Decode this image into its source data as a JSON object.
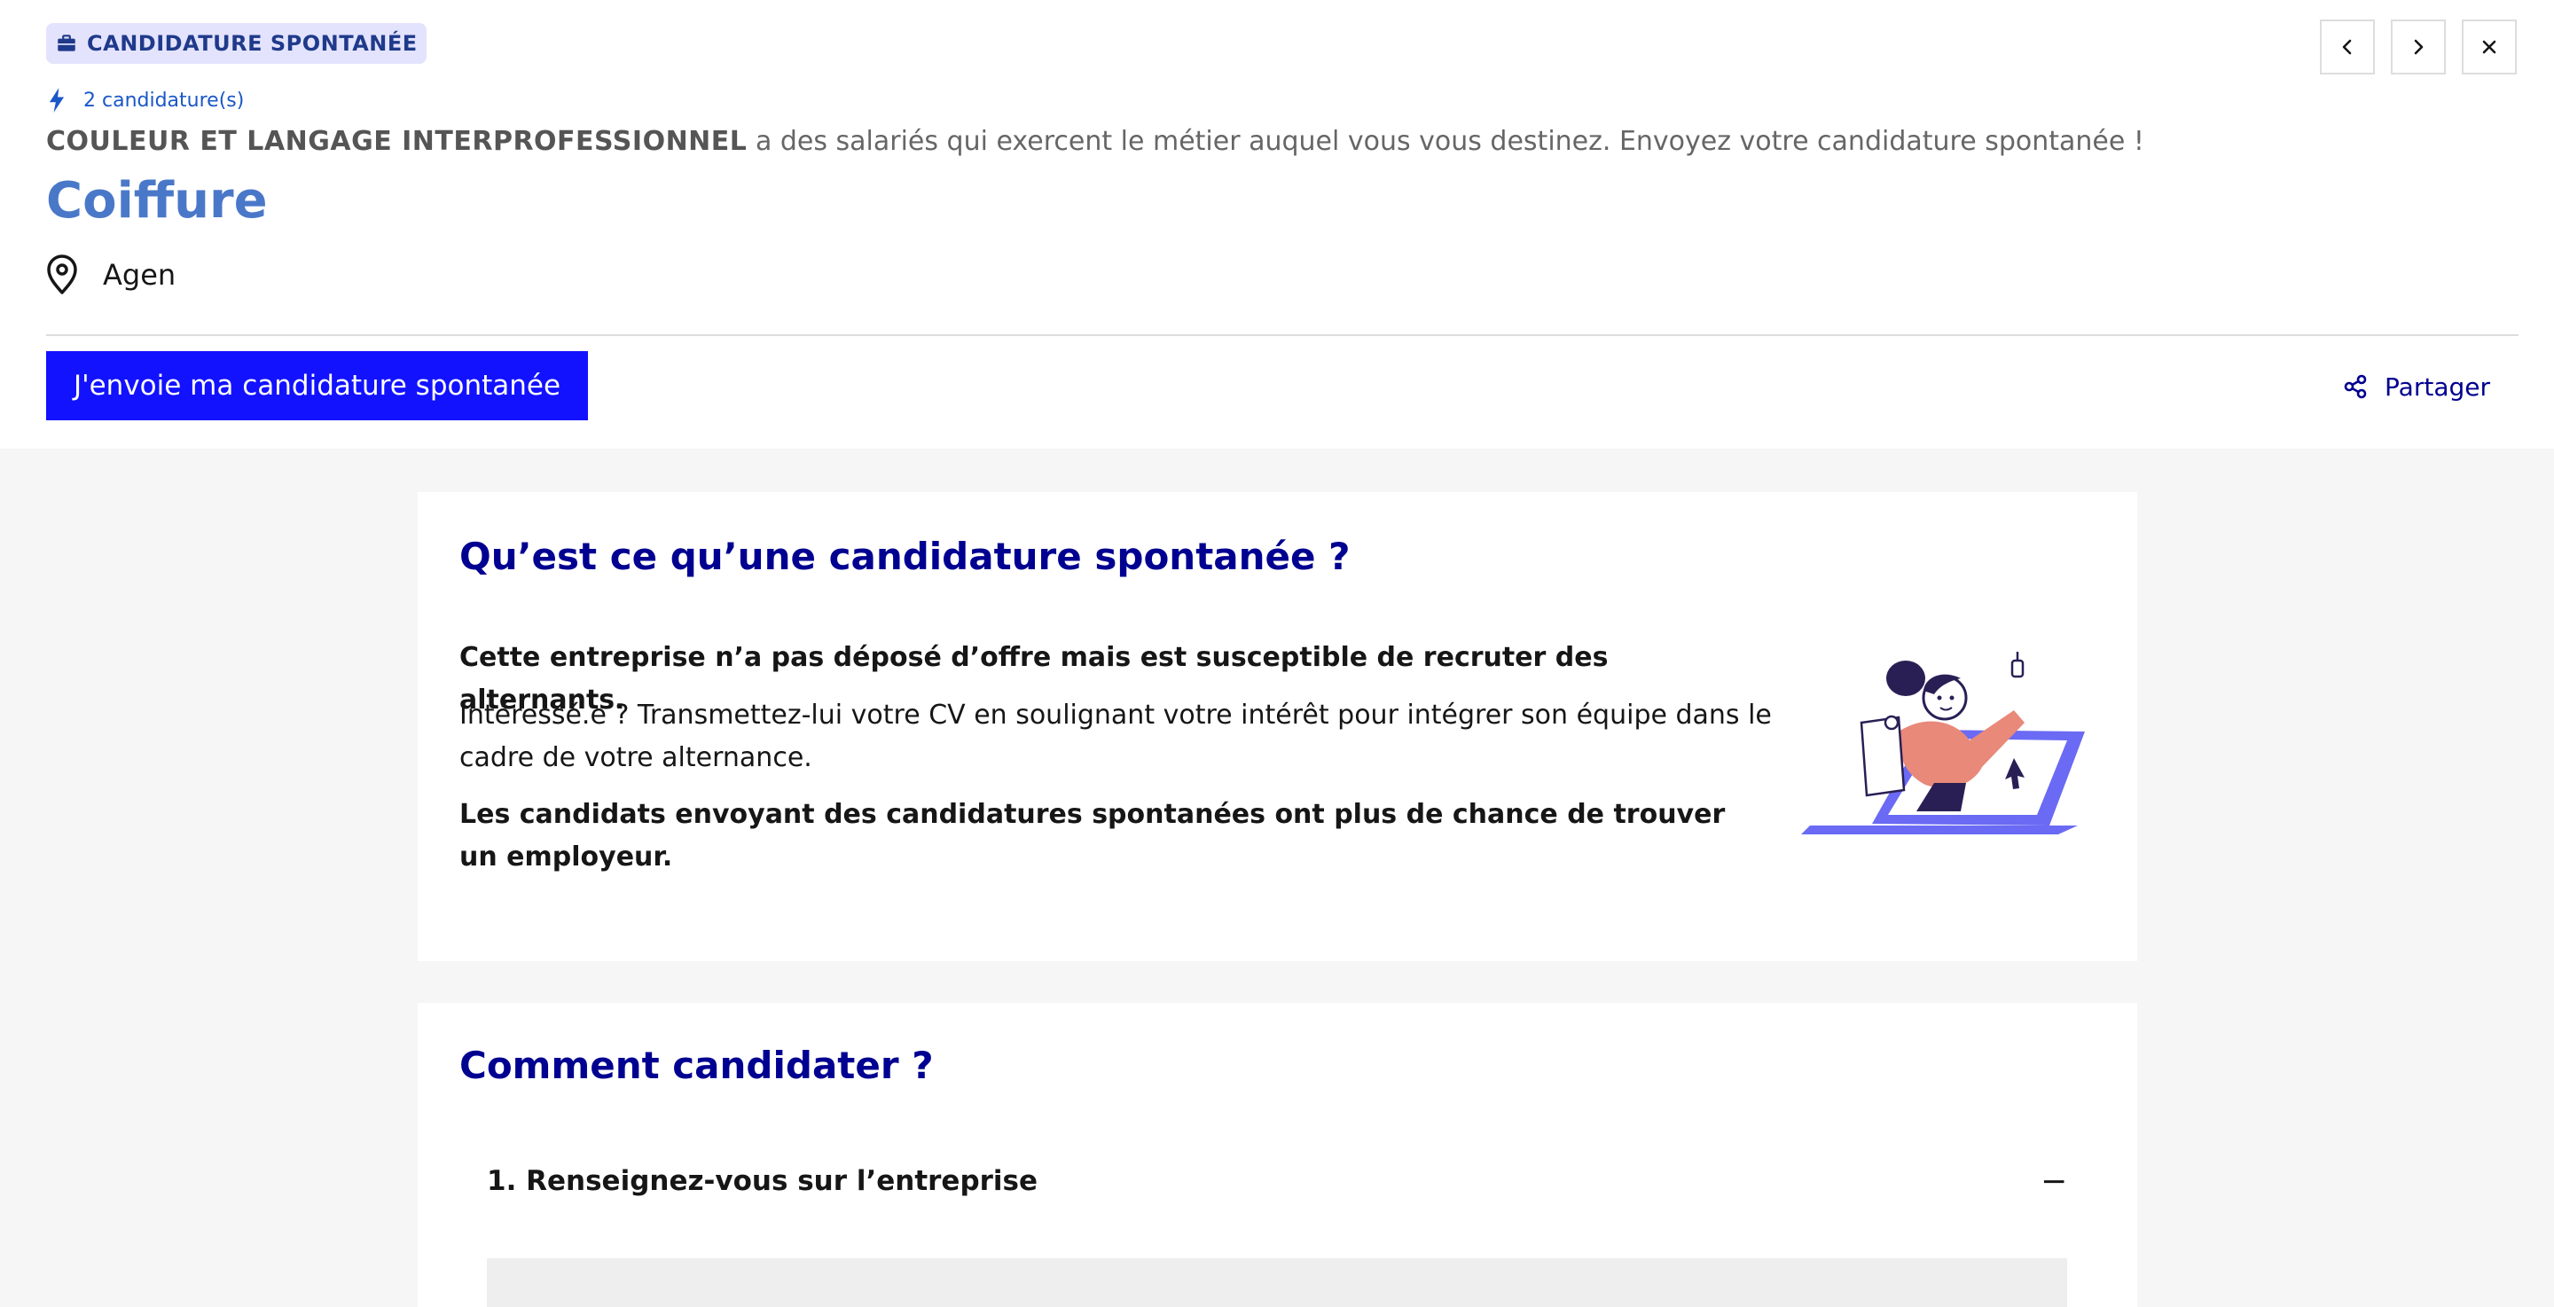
{
  "header": {
    "badge_label": "CANDIDATURE SPONTANÉE",
    "applications_count": "2 candidature(s)",
    "company_name": "COULEUR ET LANGAGE INTERPROFESSIONNEL",
    "intro_rest": " a des salariés qui exercent le métier auquel vous vous destinez. Envoyez votre candidature spontanée !",
    "job_title": "Coiffure",
    "location": "Agen",
    "apply_button": "J'envoie ma candidature spontanée",
    "share_label": "Partager",
    "nav": {
      "prev_icon": "chevron-left-icon",
      "next_icon": "chevron-right-icon",
      "close_icon": "close-icon"
    }
  },
  "what_is": {
    "title": "Qu’est ce qu’une candidature spontanée ?",
    "p1": "Cette entreprise n’a pas déposé d’offre mais est susceptible de recruter des alternants.",
    "p2": "Intéressé.e ? Transmettez-lui votre CV en soulignant votre intérêt pour intégrer son équipe dans le cadre de votre alternance.",
    "p3": "Les candidats envoyant des candidatures spontanées ont plus de chance de trouver un employeur."
  },
  "how_to": {
    "title": "Comment candidater ?",
    "step1": "1. Renseignez-vous sur l’entreprise",
    "step1_toggle": "−"
  },
  "colors": {
    "primary_blue": "#000091",
    "button_blue": "#1212ff",
    "title_blue": "#4a78c9",
    "badge_bg": "#e3e3fd",
    "illustration_purple": "#6a6af4",
    "illustration_salmon": "#e8897a"
  }
}
